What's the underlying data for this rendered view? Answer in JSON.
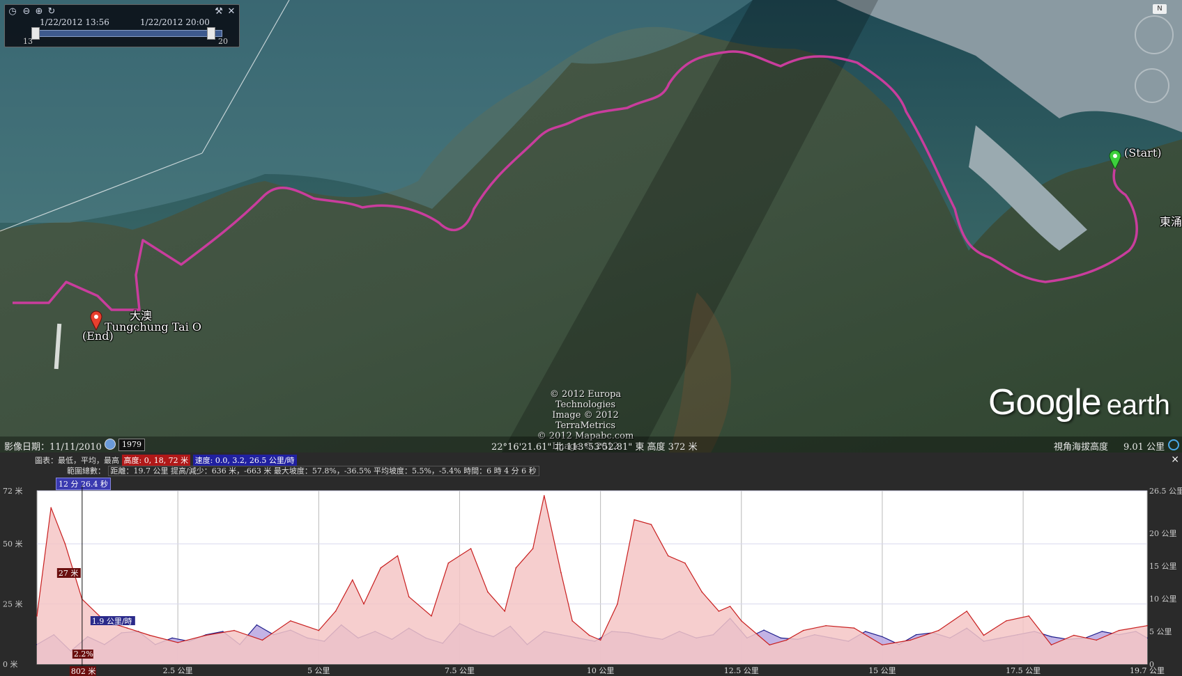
{
  "map": {
    "places": {
      "start": "(Start)",
      "end": "(End)",
      "tai_o_cn": "大澳",
      "tai_o_en": "Tungchung Tai O",
      "tung_chung": "東涌"
    },
    "credits": [
      "© 2012 Europa Technologies",
      "Image © 2012 TerraMetrics",
      "© 2012 Mapabc.com",
      "Image © 2012 DigitalGlobe"
    ],
    "logo": {
      "google": "Google",
      "earth": "earth"
    }
  },
  "time_slider": {
    "start_date": "1/22/2012 13:56",
    "end_date": "1/22/2012 20:00",
    "min_label": "13",
    "max_label": "20",
    "icons": [
      "clock-icon",
      "zoom-out-icon",
      "zoom-in-icon",
      "repeat-icon",
      "wrench-icon",
      "close-icon"
    ]
  },
  "status_bar": {
    "imagery_date": "影像日期：11/11/2010",
    "year": "1979",
    "coords": "22°16'21.61\" 北 113°53'52.81\" 東 高度  372 米",
    "eye_alt_label": "視角海拔高度",
    "eye_alt_value": "9.01 公里"
  },
  "profile": {
    "legend_label": "圖表：最低，平均，最高",
    "elev_tag": "高度: 0, 18, 72 米",
    "speed_tag": "速度: 0.0, 3.2, 26.5 公里/時",
    "range_label": "範圍總數：",
    "range_stats": "距離：19.7 公里 提高/減少：636 米，-663 米 最大坡度：57.8%，-36.5% 平均坡度：5.5%，-5.4% 時間：6 時 4 分 6 秒",
    "cursor_time": "12 分 26.4 秒",
    "cursor_elev": "27 米",
    "cursor_speed": "1.9 公里/時",
    "cursor_slope": "2.2%",
    "cursor_dist": "802 米",
    "close_label": "×"
  },
  "chart_data": {
    "type": "area",
    "x_unit": "公里",
    "xlim": [
      0,
      19.7
    ],
    "x_ticks": [
      "2.5 公里",
      "5 公里",
      "7.5 公里",
      "10 公里",
      "12.5 公里",
      "15 公里",
      "17.5 公里",
      "19.7 公里"
    ],
    "x_tick_values": [
      2.5,
      5,
      7.5,
      10,
      12.5,
      15,
      17.5,
      19.7
    ],
    "y_left_ticks": [
      "72 米",
      "50 米",
      "25 米",
      "0 米"
    ],
    "y_left_values": [
      72,
      50,
      25,
      0
    ],
    "y_right_ticks": [
      "26.5 公里",
      "20 公里",
      "15 公里",
      "10 公里",
      "5 公里",
      "0"
    ],
    "y_right_values": [
      26.5,
      20,
      15,
      10,
      5,
      0
    ],
    "ylim_left": [
      0,
      72
    ],
    "ylim_right": [
      0,
      26.5
    ],
    "series": [
      {
        "name": "高度",
        "color": "#c81e1e",
        "fill": "#f4c6c6",
        "x": [
          0,
          0.25,
          0.5,
          0.8,
          1.2,
          1.6,
          2.0,
          2.5,
          3.0,
          3.5,
          4.0,
          4.5,
          5.0,
          5.3,
          5.6,
          5.8,
          6.1,
          6.4,
          6.6,
          7.0,
          7.3,
          7.7,
          8.0,
          8.3,
          8.5,
          8.8,
          9.0,
          9.3,
          9.5,
          9.8,
          10.0,
          10.3,
          10.6,
          10.9,
          11.2,
          11.5,
          11.8,
          12.1,
          12.3,
          12.5,
          12.8,
          13.0,
          13.3,
          13.6,
          14.0,
          14.5,
          15.0,
          15.5,
          16.0,
          16.5,
          16.8,
          17.2,
          17.6,
          18.0,
          18.4,
          18.8,
          19.2,
          19.7
        ],
        "y": [
          20,
          65,
          50,
          27,
          18,
          15,
          12,
          9,
          12,
          14,
          10,
          18,
          14,
          22,
          35,
          25,
          40,
          45,
          28,
          20,
          42,
          48,
          30,
          22,
          40,
          48,
          70,
          38,
          18,
          12,
          10,
          25,
          60,
          58,
          45,
          42,
          30,
          22,
          24,
          18,
          12,
          8,
          10,
          14,
          16,
          15,
          8,
          10,
          14,
          22,
          12,
          18,
          20,
          8,
          12,
          10,
          14,
          16
        ]
      },
      {
        "name": "速度",
        "color": "#1e1e8c",
        "fill": "#b9a6e0",
        "x": [
          0,
          0.3,
          0.6,
          0.9,
          1.2,
          1.5,
          1.8,
          2.1,
          2.4,
          2.7,
          3.0,
          3.3,
          3.6,
          3.9,
          4.2,
          4.5,
          4.8,
          5.1,
          5.4,
          5.7,
          6.0,
          6.3,
          6.6,
          6.9,
          7.2,
          7.5,
          7.8,
          8.1,
          8.4,
          8.7,
          9.0,
          9.3,
          9.6,
          9.9,
          10.2,
          10.5,
          10.8,
          11.1,
          11.4,
          11.7,
          12.0,
          12.3,
          12.6,
          12.9,
          13.2,
          13.5,
          13.8,
          14.1,
          14.4,
          14.7,
          15.0,
          15.3,
          15.6,
          15.9,
          16.2,
          16.5,
          16.8,
          17.1,
          17.4,
          17.7,
          18.0,
          18.3,
          18.6,
          18.9,
          19.2,
          19.5,
          19.7
        ],
        "y": [
          3,
          4.5,
          2,
          4.2,
          3,
          4.8,
          5,
          3,
          4,
          3.5,
          4.5,
          5,
          3,
          6,
          4.5,
          5.2,
          4,
          3.5,
          6,
          4,
          5,
          3.8,
          5.5,
          4,
          3.2,
          6.2,
          5,
          4.2,
          5.8,
          3,
          5,
          4.5,
          4,
          3.5,
          5,
          4.8,
          4.2,
          3.8,
          5,
          4,
          4.5,
          7,
          4,
          5.2,
          4,
          3.8,
          4.5,
          4,
          3.5,
          5,
          4.2,
          3,
          4.5,
          4.8,
          4,
          5.5,
          3.5,
          4,
          4.5,
          5,
          4.2,
          3.8,
          4,
          5,
          4.5,
          5,
          4
        ]
      }
    ]
  }
}
